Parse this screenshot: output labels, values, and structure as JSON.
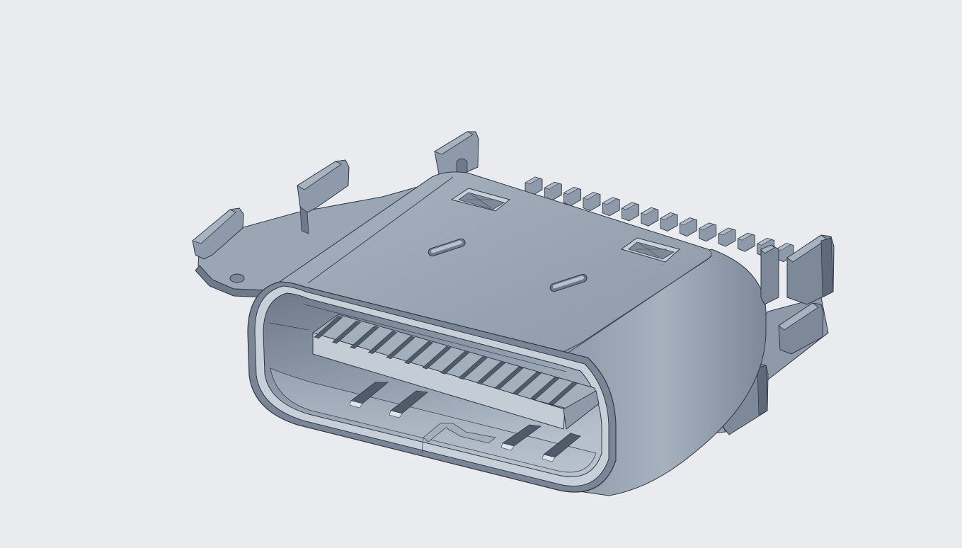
{
  "viewport": {
    "background": "#e9ebee",
    "model_name": "usb-c-receptacle-connector"
  },
  "palette": {
    "shell_top": "#9aa6b4",
    "shell_top_light": "#a9b4c1",
    "shell_side": "#7d8999",
    "shell_dark": "#5e6a79",
    "edge": "#2f3844",
    "inner_light": "#b9c3cf",
    "inner_mid": "#8e9aa9",
    "tongue_top": "#a4afbc",
    "tongue_front": "#c4ccd6",
    "pin_dark": "#4f5b69",
    "highlight": "#dfe4ea"
  }
}
